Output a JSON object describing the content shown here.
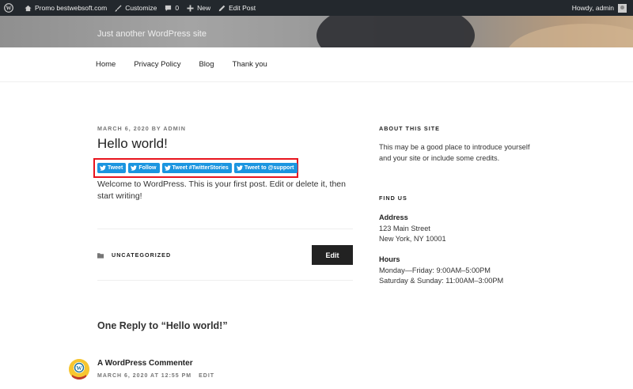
{
  "adminbar": {
    "site_name": "Promo bestwebsoft.com",
    "customize": "Customize",
    "comments_count": "0",
    "new": "New",
    "edit_post": "Edit Post",
    "howdy": "Howdy, admin"
  },
  "header": {
    "tagline": "Just another WordPress site"
  },
  "nav": {
    "items": [
      "Home",
      "Privacy Policy",
      "Blog",
      "Thank you"
    ]
  },
  "post": {
    "date": "MARCH 6, 2020",
    "by": "BY",
    "author": "ADMIN",
    "title": "Hello world!",
    "share_buttons": [
      "Tweet",
      "Follow",
      "Tweet #TwitterStories",
      "Tweet to @support"
    ],
    "content": "Welcome to WordPress. This is your first post. Edit or delete it, then start writing!",
    "category": "UNCATEGORIZED",
    "edit_label": "Edit"
  },
  "comments": {
    "title": "One Reply to “Hello world!”",
    "items": [
      {
        "author": "A WordPress Commenter",
        "date": "MARCH 6, 2020 AT 12:55 PM",
        "edit": "EDIT"
      }
    ]
  },
  "sidebar": {
    "about_title": "ABOUT THIS SITE",
    "about_text": "This may be a good place to introduce yourself and your site or include some credits.",
    "find_title": "FIND US",
    "address_label": "Address",
    "address_line1": "123 Main Street",
    "address_line2": "New York, NY 10001",
    "hours_label": "Hours",
    "hours_line1": "Monday—Friday: 9:00AM–5:00PM",
    "hours_line2": "Saturday & Sunday: 11:00AM–3:00PM"
  },
  "colors": {
    "twitter_blue": "#1b95e0",
    "highlight_red": "#e8141e",
    "adminbar_bg": "#23282d"
  }
}
